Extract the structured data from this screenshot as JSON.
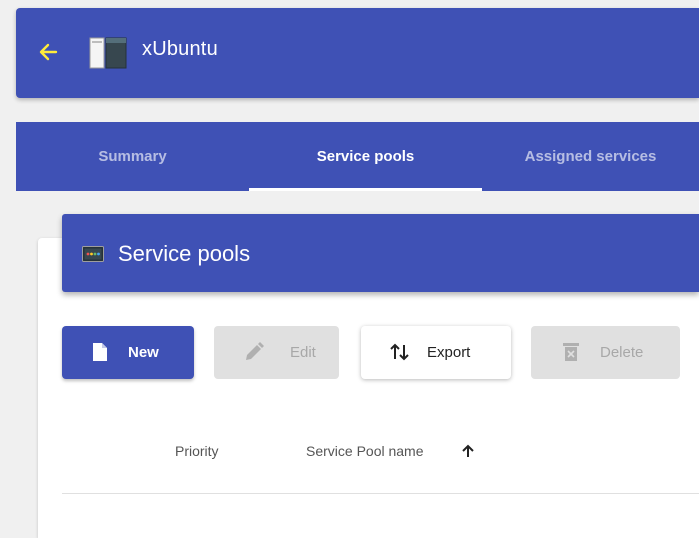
{
  "header": {
    "title": "xUbuntu",
    "back_icon": "arrow-left-icon",
    "app_icon": "pool-icon",
    "accent": "#3f51b5",
    "back_color": "#ffeb3b"
  },
  "tabs": [
    {
      "label": "Summary",
      "active": false
    },
    {
      "label": "Service pools",
      "active": true
    },
    {
      "label": "Assigned services",
      "active": false
    }
  ],
  "panel": {
    "title": "Service pools",
    "icon": "service-pools-icon"
  },
  "toolbar": {
    "new_label": "New",
    "new_icon": "file-icon",
    "edit_label": "Edit",
    "edit_icon": "pencil-icon",
    "export_label": "Export",
    "export_icon": "swap-vert-icon",
    "delete_label": "Delete",
    "delete_icon": "trash-icon"
  },
  "table": {
    "columns": [
      {
        "label": "Priority"
      },
      {
        "label": "Service Pool name",
        "sort": "ascending",
        "sort_icon": "arrow-up-icon"
      }
    ]
  }
}
